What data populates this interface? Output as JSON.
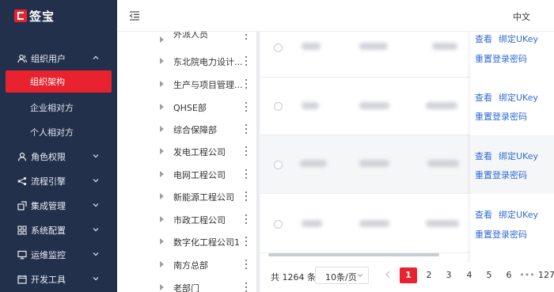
{
  "app": {
    "logo_text": "签宝",
    "logo_letter": "E"
  },
  "sidebar": {
    "groups": [
      {
        "label": "组织用户",
        "icon": "users-icon",
        "expanded": true,
        "children": [
          {
            "label": "组织架构",
            "active": true
          },
          {
            "label": "企业相对方"
          },
          {
            "label": "个人相对方"
          }
        ]
      },
      {
        "label": "角色权限",
        "icon": "user-role-icon"
      },
      {
        "label": "流程引擎",
        "icon": "flow-icon"
      },
      {
        "label": "集成管理",
        "icon": "integration-icon"
      },
      {
        "label": "系统配置",
        "icon": "grid-config-icon"
      },
      {
        "label": "运维监控",
        "icon": "monitor-icon"
      },
      {
        "label": "开发工具",
        "icon": "dev-tool-icon"
      }
    ]
  },
  "header": {
    "language": "中文"
  },
  "tree": {
    "nodes": [
      {
        "label": "外派人员"
      },
      {
        "label": "东北院电力设计..."
      },
      {
        "label": "生产与项目管理..."
      },
      {
        "label": "QHSE部"
      },
      {
        "label": "综合保障部"
      },
      {
        "label": "发电工程公司"
      },
      {
        "label": "电网工程公司"
      },
      {
        "label": "新能源工程公司"
      },
      {
        "label": "市政工程公司"
      },
      {
        "label": "数字化工程公司1"
      },
      {
        "label": "南方总部"
      },
      {
        "label": "老部门"
      }
    ]
  },
  "table": {
    "rows": [
      {
        "actions": {
          "view": "查看",
          "bind": "绑定UKey",
          "reset": "重置登录密码"
        }
      },
      {
        "actions": {
          "view": "查看",
          "bind": "绑定UKey",
          "reset": "重置登录密码"
        }
      },
      {
        "actions": {
          "view": "查看",
          "bind": "绑定UKey",
          "reset": "重置登录密码"
        },
        "highlighted": true
      },
      {
        "actions": {
          "view": "查看",
          "bind": "绑定UKey",
          "reset": "重置登录密码"
        }
      }
    ]
  },
  "pagination": {
    "total_text": "共 1264 条",
    "page_size": "10条/页",
    "pages": [
      "1",
      "2",
      "3",
      "4",
      "5",
      "6",
      "•••",
      "127"
    ],
    "current": "1"
  },
  "colors": {
    "accent": "#e8232f",
    "sidebar_bg": "#23304b",
    "link": "#2f6bd8"
  }
}
